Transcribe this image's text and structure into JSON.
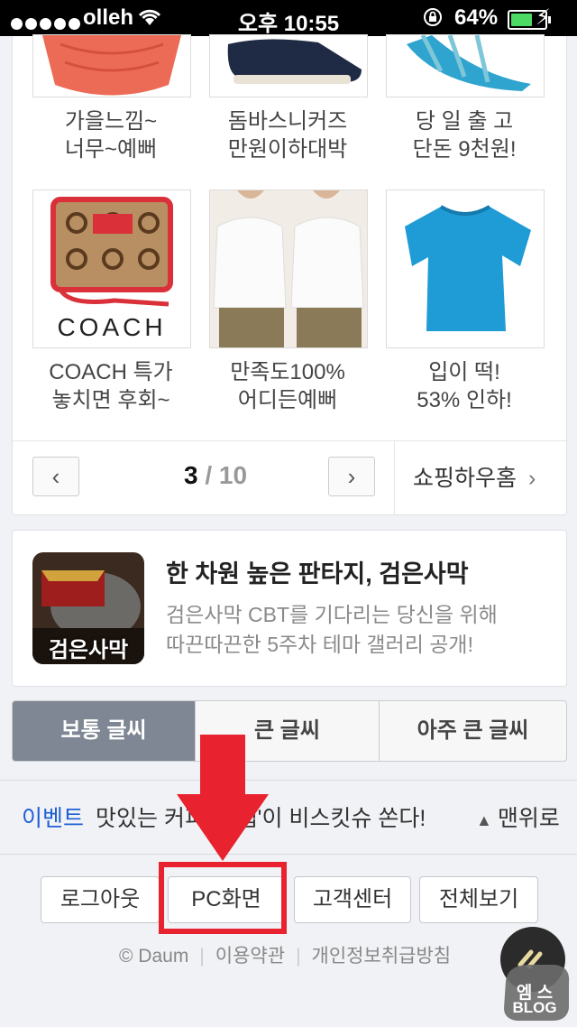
{
  "status_bar": {
    "carrier": "olleh",
    "time": "오후 10:55",
    "battery": "64%",
    "battery_level": 0.64
  },
  "shopping": {
    "products": [
      {
        "line1": "가을느낌~",
        "line2": "너무~예뻐",
        "image": "red-knit-sweater"
      },
      {
        "line1": "돔바스니커즈",
        "line2": "만원이하대박",
        "image": "navy-sneakers"
      },
      {
        "line1": "당 일 출 고",
        "line2": "단돈 9천원!",
        "image": "blue-sandals"
      },
      {
        "line1": "COACH 특가",
        "line2": "놓치면 후회~",
        "image": "coach-wallet",
        "brand_text": "COACH"
      },
      {
        "line1": "만족도100%",
        "line2": "어디든예뻐",
        "image": "white-blouse"
      },
      {
        "line1": "입이 떡!",
        "line2": "53% 인하!",
        "image": "blue-tshirt"
      }
    ],
    "pager": {
      "current": "3",
      "sep_total": " / 10"
    },
    "home_link": "쇼핑하우홈"
  },
  "ad": {
    "title": "한 차원 높은 판타지, 검은사막",
    "desc_line1": "검은사막 CBT를 기다리는 당신을 위해",
    "desc_line2": "따끈따끈한 5주차 테마 갤러리 공개!",
    "thumb_text": "검은사막"
  },
  "font_size": {
    "options": [
      "보통 글씨",
      "큰 글씨",
      "아주 큰 글씨"
    ],
    "selected": 0
  },
  "event": {
    "label": "이벤트",
    "text": "맛있는 커피 '스냅'이 비스킷슈 쏜다!",
    "to_top": "맨위로"
  },
  "footer": {
    "buttons": [
      "로그아웃",
      "PC화면",
      "고객센터",
      "전체보기"
    ],
    "links": [
      "© Daum",
      "이용약관",
      "개인정보취급방침"
    ]
  },
  "overlay": {
    "badge_line1": "엠 스",
    "badge_line2": "BLOG"
  },
  "colors": {
    "accent": "#1e5fd6",
    "annotation_red": "#e8222e",
    "selected_segment": "#7e8793",
    "battery_green": "#4cd964"
  }
}
